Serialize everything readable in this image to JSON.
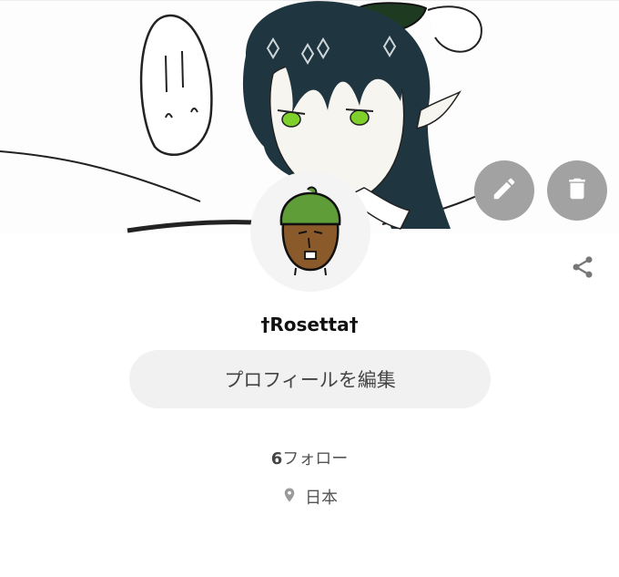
{
  "profile": {
    "username": "†Rosetta†",
    "edit_profile_label": "プロフィールを編集",
    "follow_count": "6",
    "follow_label": "フォロー",
    "location": "日本"
  },
  "actions": {
    "edit_icon": "pencil-icon",
    "delete_icon": "trash-icon",
    "share_icon": "share-icon"
  },
  "colors": {
    "action_button_bg": "#a2a2a2",
    "edit_profile_bg": "#f1f1f1",
    "hair": "#1f3540",
    "eyes": "#7fd02a",
    "avatar_cap": "#5f9d38",
    "avatar_face": "#8a5a2b"
  }
}
